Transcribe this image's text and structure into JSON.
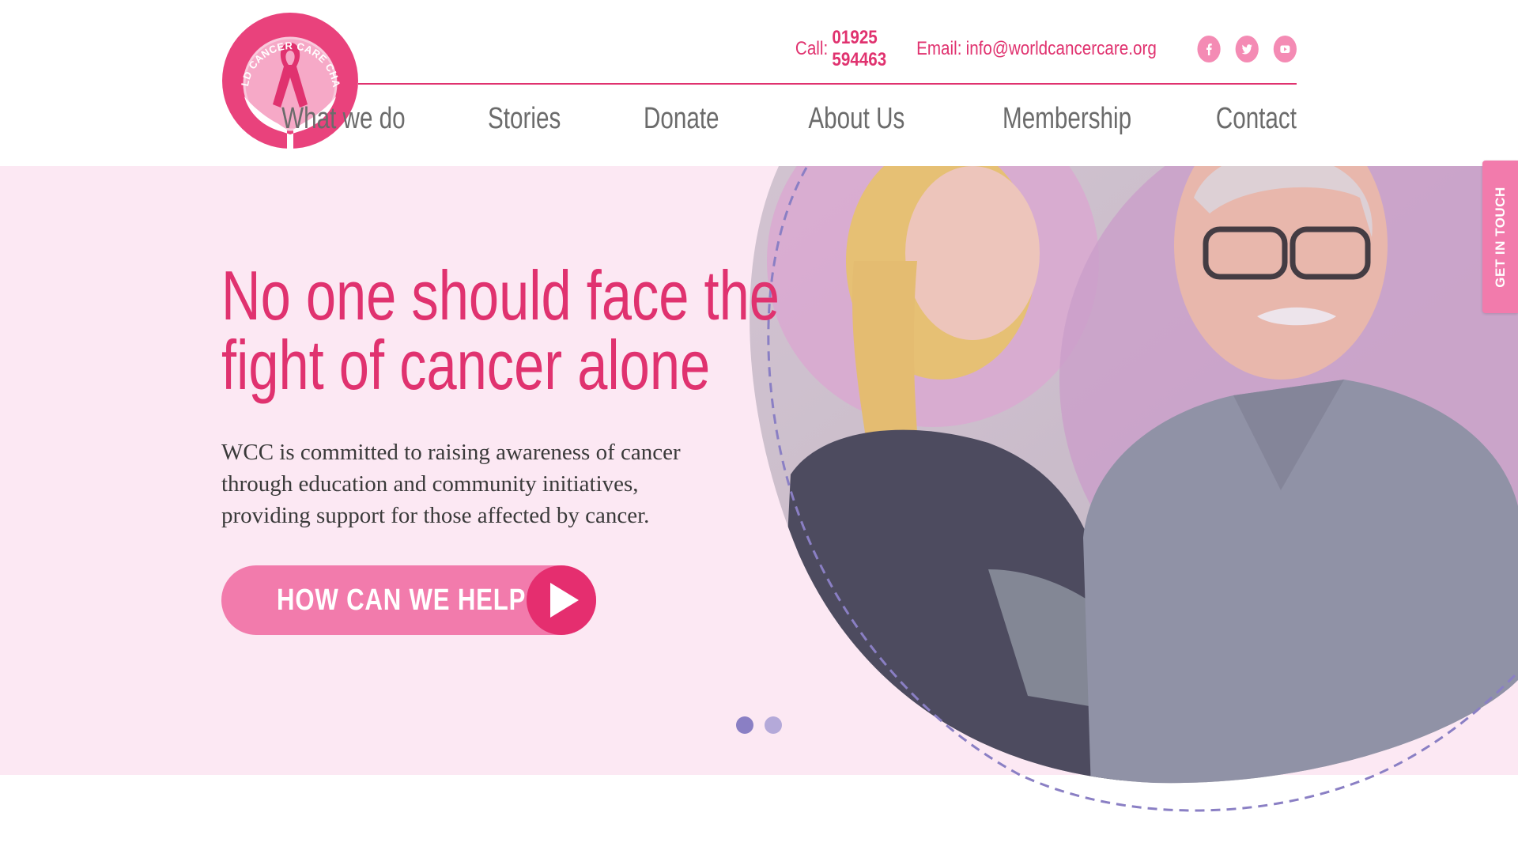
{
  "brand": {
    "logo_text": "WORLD CANCER CARE CHARITY",
    "pink": "#e0326f",
    "light_pink": "#f27bac",
    "hero_bg": "#fce8f3",
    "nav_text": "#6b6b6b",
    "dot_active": "#8a7fc4",
    "dot_inactive": "#b4a9d9"
  },
  "header": {
    "call_label": "Call:",
    "phone": "01925 594463",
    "email_label": "Email:",
    "email": "info@worldcancercare.org",
    "socials": [
      "facebook-icon",
      "twitter-icon",
      "youtube-icon"
    ]
  },
  "nav": {
    "items": [
      "What we do",
      "Stories",
      "Donate",
      "About Us",
      "Membership",
      "Contact"
    ]
  },
  "hero": {
    "headline_line1": "No one should face the",
    "headline_line2": "fight of cancer alone",
    "body": "WCC is committed to raising awareness of cancer through education and community initiatives, providing support for those affected by cancer.",
    "cta_label": "HOW CAN WE HELP?",
    "slides_total": 2,
    "slide_active": 1
  },
  "side_tab": {
    "label": "GET IN TOUCH"
  }
}
